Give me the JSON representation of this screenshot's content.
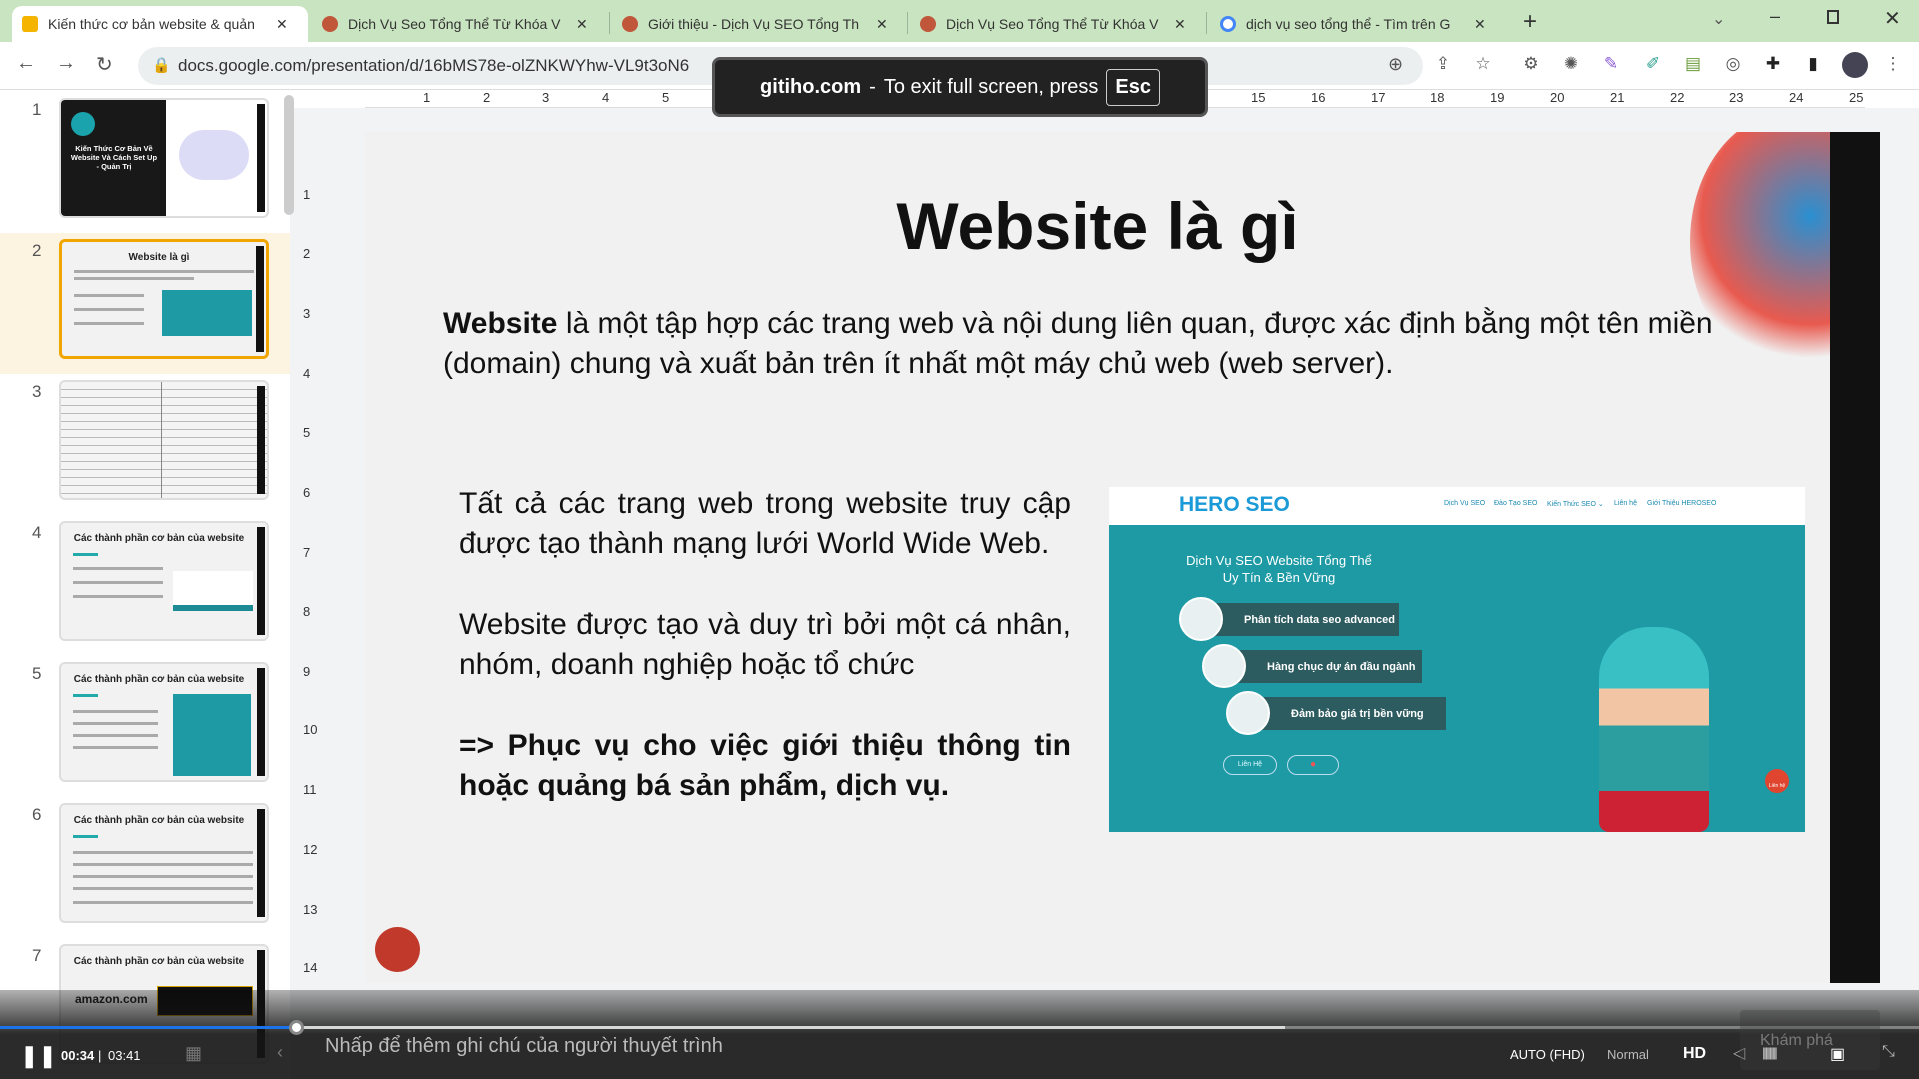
{
  "tabs": [
    {
      "title": "Kiến thức cơ bản website & quản",
      "active": true,
      "color": "#f4b400"
    },
    {
      "title": "Dịch Vụ Seo Tổng Thể Từ Khóa V",
      "color": "#c0563a"
    },
    {
      "title": "Giới thiệu - Dịch Vụ SEO Tổng Th",
      "color": "#c0563a"
    },
    {
      "title": "Dịch Vụ Seo Tổng Thể Từ Khóa V",
      "color": "#c0563a"
    },
    {
      "title": "dịch vụ seo tổng thể - Tìm trên G",
      "color": "#4285f4"
    }
  ],
  "tab_close": "✕",
  "new_tab": "+",
  "address": {
    "url": "docs.google.com/presentation/d/16bMS78e-olZNKWYhw-VL9t3oN6"
  },
  "fullscreen_msg": {
    "site": "gitiho.com",
    "dash": "-",
    "text": "To exit full screen, press",
    "key": "Esc"
  },
  "ruler": {
    "left": [
      "1",
      "2",
      "3",
      "4",
      "5"
    ],
    "right": [
      "15",
      "16",
      "17",
      "18",
      "19",
      "20",
      "21",
      "22",
      "23",
      "24",
      "25"
    ],
    "vertical": [
      "1",
      "2",
      "3",
      "4",
      "5",
      "6",
      "7",
      "8",
      "9",
      "10",
      "11",
      "12",
      "13",
      "14"
    ]
  },
  "thumbnails": [
    {
      "num": "1",
      "title": "Kiến Thức Cơ Bản Về Website Và Cách Set Up - Quản Trị"
    },
    {
      "num": "2",
      "title": "Website là gì"
    },
    {
      "num": "3",
      "title": ""
    },
    {
      "num": "4",
      "title": "Các thành phần cơ bản của website"
    },
    {
      "num": "5",
      "title": "Các thành phần cơ bản của website"
    },
    {
      "num": "6",
      "title": "Các thành phần cơ bản của website"
    },
    {
      "num": "7",
      "title": "Các thành phần cơ bản của website"
    }
  ],
  "slide": {
    "title": "Website là gì",
    "para_bold": "Website",
    "para_rest": " là một tập hợp các trang web và nội dung liên quan, được xác định bằng một tên miền (domain) chung và xuất bản trên ít nhất một máy chủ web (web server).",
    "p1": "Tất cả các trang web trong website truy cập được tạo thành mạng lưới World Wide Web.",
    "p2": "Website được tạo và duy trì bởi một cá nhân, nhóm, doanh nghiệp hoặc tổ chức",
    "p3": "=> Phục vụ cho việc giới thiệu thông tin hoặc quảng bá sản phẩm, dịch vụ.",
    "screenshot": {
      "logo": "HERO SEO",
      "nav": [
        "Dịch Vụ SEO",
        "Đào Tạo SEO",
        "Kiến Thức SEO ⌄",
        "Liên hệ",
        "Giới Thiệu HEROSEO"
      ],
      "headline1": "Dịch Vụ SEO Website Tổng Thể",
      "headline2": "Uy Tín & Bền Vững",
      "features": [
        "Phân tích data seo advanced",
        "Hàng chục dự án đầu ngành",
        "Đảm bảo giá trị bền vững"
      ],
      "contact_btn": "Liên Hệ",
      "chat_label": "Liên hệ"
    }
  },
  "notes_placeholder": "Nhấp để thêm ghi chú của người thuyết trình",
  "player": {
    "current": "00:34",
    "separator": "|",
    "duration": "03:41",
    "progress_percent": 15.4,
    "quality": "AUTO (FHD)",
    "speed": "Normal",
    "hd": "HD",
    "explore": "Khám phá"
  }
}
